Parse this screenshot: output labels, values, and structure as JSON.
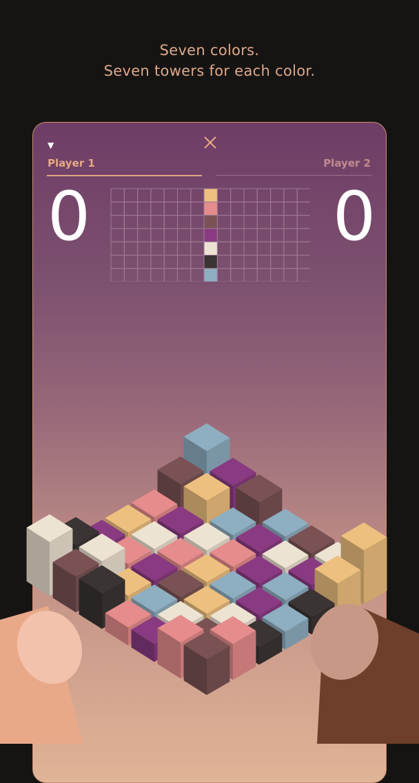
{
  "caption": {
    "line1": "Seven colors.",
    "line2": "Seven towers for each color."
  },
  "header": {
    "menu_icon": "triangle-down-icon",
    "close_icon": "close-icon",
    "player1_label": "Player 1",
    "player2_label": "Player 2"
  },
  "scores": {
    "player1": "0",
    "player2": "0"
  },
  "colors": {
    "background": "#161413",
    "accent": "#e4a887",
    "palette": [
      "#eec07f",
      "#e68c8c",
      "#7a5254",
      "#8a3a82",
      "#ede3d2",
      "#3b3434",
      "#8eaec1"
    ]
  }
}
